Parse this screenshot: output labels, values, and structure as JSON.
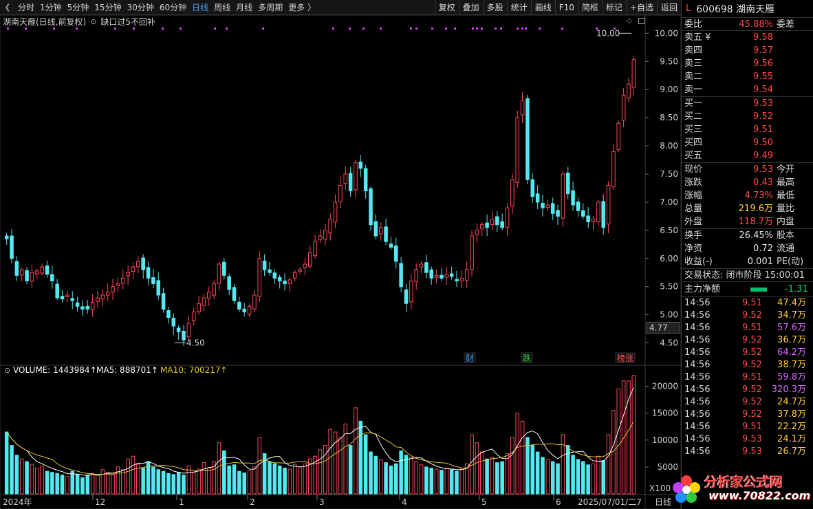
{
  "toolbar": {
    "period_tabs": [
      "分时",
      "1分钟",
      "5分钟",
      "15分钟",
      "30分钟",
      "60分钟",
      "日线",
      "周线",
      "月线",
      "多周期",
      "更多 〉"
    ],
    "active_tab": "日线",
    "buttons": [
      "复权",
      "叠加",
      "多股",
      "统计",
      "画线",
      "F10",
      "简框",
      "标记",
      "+自选",
      "返回"
    ]
  },
  "kline": {
    "title": "湖南天雁(日线,前复权)",
    "option": "缺口过5不回补",
    "price_axis": [
      "10.00",
      "9.50",
      "9.00",
      "8.50",
      "8.00",
      "7.50",
      "7.00",
      "6.50",
      "6.00",
      "5.50",
      "5.00",
      "4.50"
    ],
    "price_range": [
      4.25,
      10.2
    ],
    "current_price_label": "4.77",
    "high_annotation": "10.00",
    "low_annotation": "4.50",
    "event_markers": [
      "财",
      "跌",
      "榜涨"
    ]
  },
  "volume": {
    "indicator_label": "VOLUME: 1443984",
    "ma5_label": "MA5: 888701",
    "ma10_label": "MA10: 700217",
    "axis": [
      "20000",
      "15000",
      "10000",
      "5000"
    ],
    "unit": "X100",
    "max": 22500
  },
  "date_axis": [
    "2024年",
    "12",
    "1",
    "2",
    "3",
    "4",
    "5",
    "6",
    "2025/07/01/二7"
  ],
  "date_axis_right": "日线",
  "colors": {
    "up": "#ff4a5a",
    "down": "#54e8f0",
    "ma5": "#ffffff",
    "ma10": "#e8c53a",
    "marker": "#e040fb"
  },
  "quote": {
    "mark": "L",
    "code_name": "600698 湖南天雁",
    "webi": {
      "label": "委比",
      "value": "45.88%",
      "label2": "委差"
    },
    "sell": [
      {
        "label": "卖五 ¥",
        "price": "9.58"
      },
      {
        "label": "卖四",
        "price": "9.57"
      },
      {
        "label": "卖三",
        "price": "9.56"
      },
      {
        "label": "卖二",
        "price": "9.55"
      },
      {
        "label": "卖一",
        "price": "9.54"
      }
    ],
    "buy": [
      {
        "label": "买一",
        "price": "9.53"
      },
      {
        "label": "买二",
        "price": "9.52"
      },
      {
        "label": "买三",
        "price": "9.51"
      },
      {
        "label": "买四",
        "price": "9.50"
      },
      {
        "label": "买五",
        "price": "9.49"
      }
    ],
    "stats": [
      {
        "label": "现价",
        "value": "9.53",
        "label2": "今开",
        "color": "red"
      },
      {
        "label": "涨跌",
        "value": "0.43",
        "label2": "最高",
        "color": "red"
      },
      {
        "label": "涨幅",
        "value": "4.73%",
        "label2": "最低",
        "color": "red"
      },
      {
        "label": "总量",
        "value": "219.6万",
        "label2": "量比",
        "color": "yellow"
      },
      {
        "label": "外盘",
        "value": "118.7万",
        "label2": "内盘",
        "color": "red"
      }
    ],
    "stats2": [
      {
        "label": "换手",
        "value": "26.45%",
        "label2": "股本",
        "color": "white"
      },
      {
        "label": "净资",
        "value": "0.72",
        "label2": "流通",
        "color": "white"
      },
      {
        "label": "收益(-)",
        "value": "0.001",
        "label2": "PE(动)",
        "color": "white"
      }
    ],
    "status": "交易状态: 闭市阶段 15:00:01",
    "main_flow": {
      "label": "主力净额",
      "value": "-1.31"
    },
    "trades": [
      {
        "time": "14:56",
        "price": "9.51",
        "vol": "47.4万",
        "color": "yellow"
      },
      {
        "time": "14:56",
        "price": "9.52",
        "vol": "34.7万",
        "color": "yellow"
      },
      {
        "time": "14:56",
        "price": "9.51",
        "vol": "57.6万",
        "color": "purple"
      },
      {
        "time": "14:56",
        "price": "9.52",
        "vol": "36.7万",
        "color": "yellow"
      },
      {
        "time": "14:56",
        "price": "9.52",
        "vol": "64.2万",
        "color": "purple"
      },
      {
        "time": "14:56",
        "price": "9.52",
        "vol": "38.7万",
        "color": "yellow"
      },
      {
        "time": "14:56",
        "price": "9.51",
        "vol": "59.8万",
        "color": "purple"
      },
      {
        "time": "14:56",
        "price": "9.52",
        "vol": "320.3万",
        "color": "purple"
      },
      {
        "time": "14:56",
        "price": "9.52",
        "vol": "24.7万",
        "color": "yellow"
      },
      {
        "time": "14:56",
        "price": "9.52",
        "vol": "37.8万",
        "color": "yellow"
      },
      {
        "time": "14:56",
        "price": "9.51",
        "vol": "22.2万",
        "color": "yellow"
      },
      {
        "time": "14:56",
        "price": "9.53",
        "vol": "24.1万",
        "color": "yellow"
      },
      {
        "time": "14:56",
        "price": "9.53",
        "vol": "26.7万",
        "color": "yellow"
      }
    ]
  },
  "logo": {
    "brand": "分析家公式网",
    "url": "www.70822.com"
  },
  "chart_data": {
    "type": "candlestick",
    "title": "湖南天雁(日线,前复权)",
    "price_ylim": [
      4.25,
      10.2
    ],
    "volume_ylim": [
      0,
      22500
    ],
    "x_labels": [
      "2024年",
      "12",
      "1",
      "2",
      "3",
      "4",
      "5",
      "6",
      "2025/07/01/二7"
    ],
    "last_close": 9.53,
    "period_high": 10.0,
    "period_low": 4.5,
    "volume_last": 1443984,
    "ma5_last": 888701,
    "ma10_last": 700217,
    "close": [
      6.35,
      6.0,
      5.7,
      5.8,
      5.6,
      5.75,
      5.78,
      5.85,
      5.72,
      5.6,
      5.3,
      5.28,
      5.35,
      5.25,
      5.15,
      5.1,
      5.1,
      5.22,
      5.3,
      5.35,
      5.4,
      5.5,
      5.55,
      5.65,
      5.75,
      5.85,
      5.95,
      5.8,
      5.65,
      5.55,
      5.35,
      5.1,
      4.95,
      4.8,
      4.7,
      4.55,
      4.85,
      5.05,
      5.2,
      5.3,
      5.4,
      5.55,
      5.9,
      5.7,
      5.45,
      5.25,
      5.1,
      5.05,
      5.15,
      5.35,
      6.0,
      5.8,
      5.75,
      5.65,
      5.6,
      5.55,
      5.62,
      5.75,
      5.8,
      5.9,
      6.1,
      6.3,
      6.4,
      6.5,
      6.7,
      7.0,
      7.3,
      7.5,
      7.2,
      7.7,
      7.6,
      7.2,
      6.6,
      6.4,
      6.55,
      6.3,
      6.2,
      5.95,
      5.5,
      5.2,
      5.6,
      5.8,
      5.9,
      5.75,
      5.65,
      5.7,
      5.65,
      5.72,
      5.68,
      5.6,
      5.65,
      5.8,
      6.4,
      6.5,
      6.6,
      6.55,
      6.7,
      6.6,
      6.55,
      6.9,
      7.4,
      8.5,
      8.8,
      7.4,
      7.1,
      7.0,
      6.9,
      6.95,
      6.8,
      6.75,
      7.5,
      7.15,
      6.95,
      6.85,
      6.75,
      6.65,
      6.7,
      7.0,
      6.55,
      7.3,
      7.9,
      8.4,
      8.9,
      9.1,
      9.53
    ],
    "volume": [
      11500,
      9000,
      7200,
      6500,
      6000,
      5500,
      4800,
      5200,
      4200,
      4000,
      3800,
      3500,
      3200,
      4200,
      3600,
      3000,
      3400,
      3800,
      3500,
      4500,
      4000,
      3600,
      5000,
      4500,
      6500,
      7000,
      5500,
      4800,
      6000,
      5000,
      4500,
      4200,
      3800,
      3600,
      4000,
      3500,
      5200,
      4000,
      4600,
      5800,
      4800,
      6000,
      9500,
      8000,
      5200,
      5400,
      4200,
      3900,
      4300,
      5000,
      10500,
      7500,
      6000,
      5600,
      5200,
      4800,
      4600,
      5500,
      5000,
      5600,
      6500,
      7000,
      8200,
      9000,
      12000,
      11500,
      10500,
      13000,
      9000,
      16000,
      13500,
      11000,
      7800,
      7000,
      6400,
      5800,
      5200,
      5600,
      8000,
      7200,
      6800,
      6000,
      5400,
      5000,
      4800,
      4600,
      4400,
      4800,
      4500,
      4200,
      4600,
      5600,
      11000,
      9500,
      7800,
      6500,
      6800,
      5800,
      6000,
      7500,
      10500,
      15000,
      13500,
      10500,
      9000,
      7800,
      6800,
      6400,
      6000,
      5600,
      11000,
      9000,
      7200,
      6400,
      6000,
      5400,
      5600,
      7000,
      6200,
      11000,
      15500,
      19500,
      21000,
      21000,
      22000
    ]
  }
}
